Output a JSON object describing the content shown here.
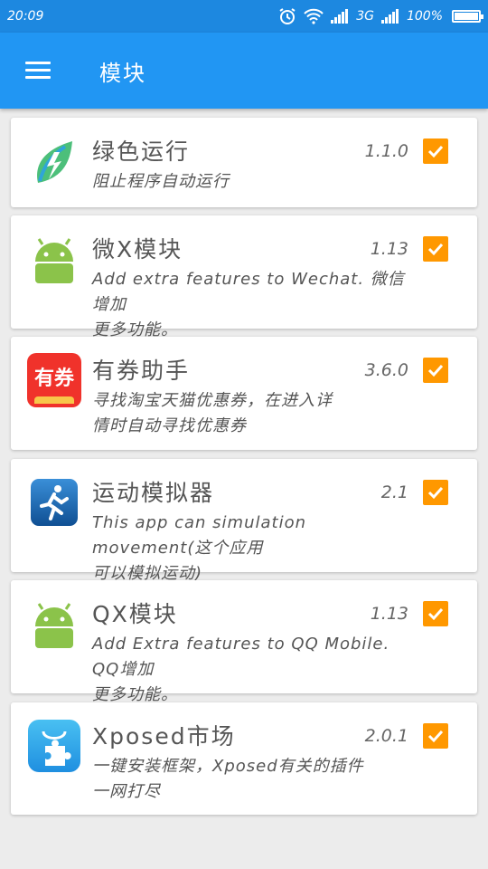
{
  "status_bar": {
    "time": "20:09",
    "network": "3G",
    "battery": "100%",
    "icons": [
      "alarm-icon",
      "wifi-icon",
      "signal-icon",
      "signal-icon",
      "battery-icon"
    ]
  },
  "app_bar": {
    "title": "模块",
    "menu_icon": "hamburger-menu-icon"
  },
  "colors": {
    "status_bar": "#1d88e0",
    "app_bar": "#2196f3",
    "checkbox": "#ff9800",
    "background": "#ececec"
  },
  "modules": [
    {
      "name": "绿色运行",
      "version": "1.1.0",
      "desc_line1": "阻止程序自动运行",
      "desc_line2": "",
      "checked": true,
      "icon": "leaf-lightning-icon"
    },
    {
      "name": "微X模块",
      "version": "1.13",
      "desc_line1": "Add extra features to Wechat. 微信增加",
      "desc_line2": "更多功能。",
      "checked": true,
      "icon": "android-icon"
    },
    {
      "name": "有券助手",
      "version": "3.6.0",
      "desc_line1": "寻找淘宝天猫优惠券，在进入详",
      "desc_line2": "情时自动寻找优惠券",
      "checked": true,
      "icon": "coupon-app-icon",
      "icon_text": "有券"
    },
    {
      "name": "运动模拟器",
      "version": "2.1",
      "desc_line1": "This app can simulation movement(这个应用",
      "desc_line2": "可以模拟运动)",
      "checked": true,
      "icon": "running-man-icon"
    },
    {
      "name": "QX模块",
      "version": "1.13",
      "desc_line1": "Add Extra features to QQ Mobile. QQ增加",
      "desc_line2": "更多功能。",
      "checked": true,
      "icon": "android-icon"
    },
    {
      "name": "Xposed市场",
      "version": "2.0.1",
      "desc_line1": "一键安装框架，Xposed有关的插件",
      "desc_line2": "一网打尽",
      "checked": true,
      "icon": "puzzle-bag-icon"
    }
  ]
}
